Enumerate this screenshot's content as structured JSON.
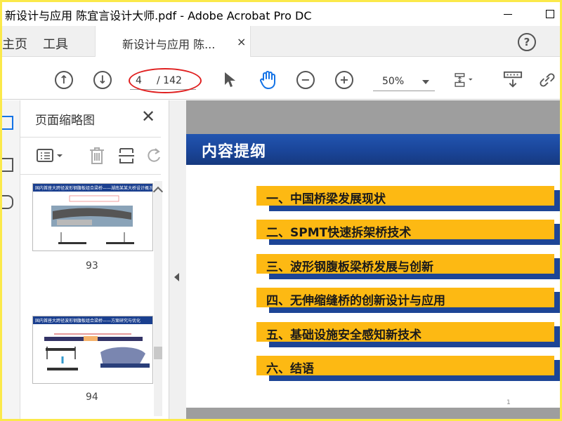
{
  "window": {
    "title": "新设计与应用  陈宜言设计大师.pdf - Adobe Acrobat Pro DC"
  },
  "nav": {
    "home": "主页",
    "tools": "工具",
    "doc_tab": "新设计与应用   陈...",
    "doc_tab_close": "×",
    "help": "?"
  },
  "toolbar": {
    "page_current": "4",
    "page_total": "/ 142",
    "zoom": "50%"
  },
  "panel": {
    "title": "页面缩略图",
    "close": "✕",
    "thumbnails": [
      {
        "header": "国内首座大跨径波形钢腹板组合梁桥——湖南某某大桥设计概况",
        "page": "93"
      },
      {
        "header": "国内首座大跨径波形钢腹板组合梁桥——方案研究与优化",
        "page": "94"
      }
    ]
  },
  "slide": {
    "title": "内容提纲",
    "items": [
      "一、中国桥梁发展现状",
      "二、SPMT快速拆架桥技术",
      "三、波形钢腹板梁桥发展与创新",
      "四、无伸缩缝桥的创新设计与应用",
      "五、基础设施安全感知新技术",
      "六、结语"
    ],
    "page_number": "1"
  },
  "colors": {
    "slide_header": "#1a4599",
    "bar_front": "#fdb913",
    "bar_back": "#1d4596",
    "page_highlight": "#e02020",
    "screen_border": "#fbe94a"
  }
}
